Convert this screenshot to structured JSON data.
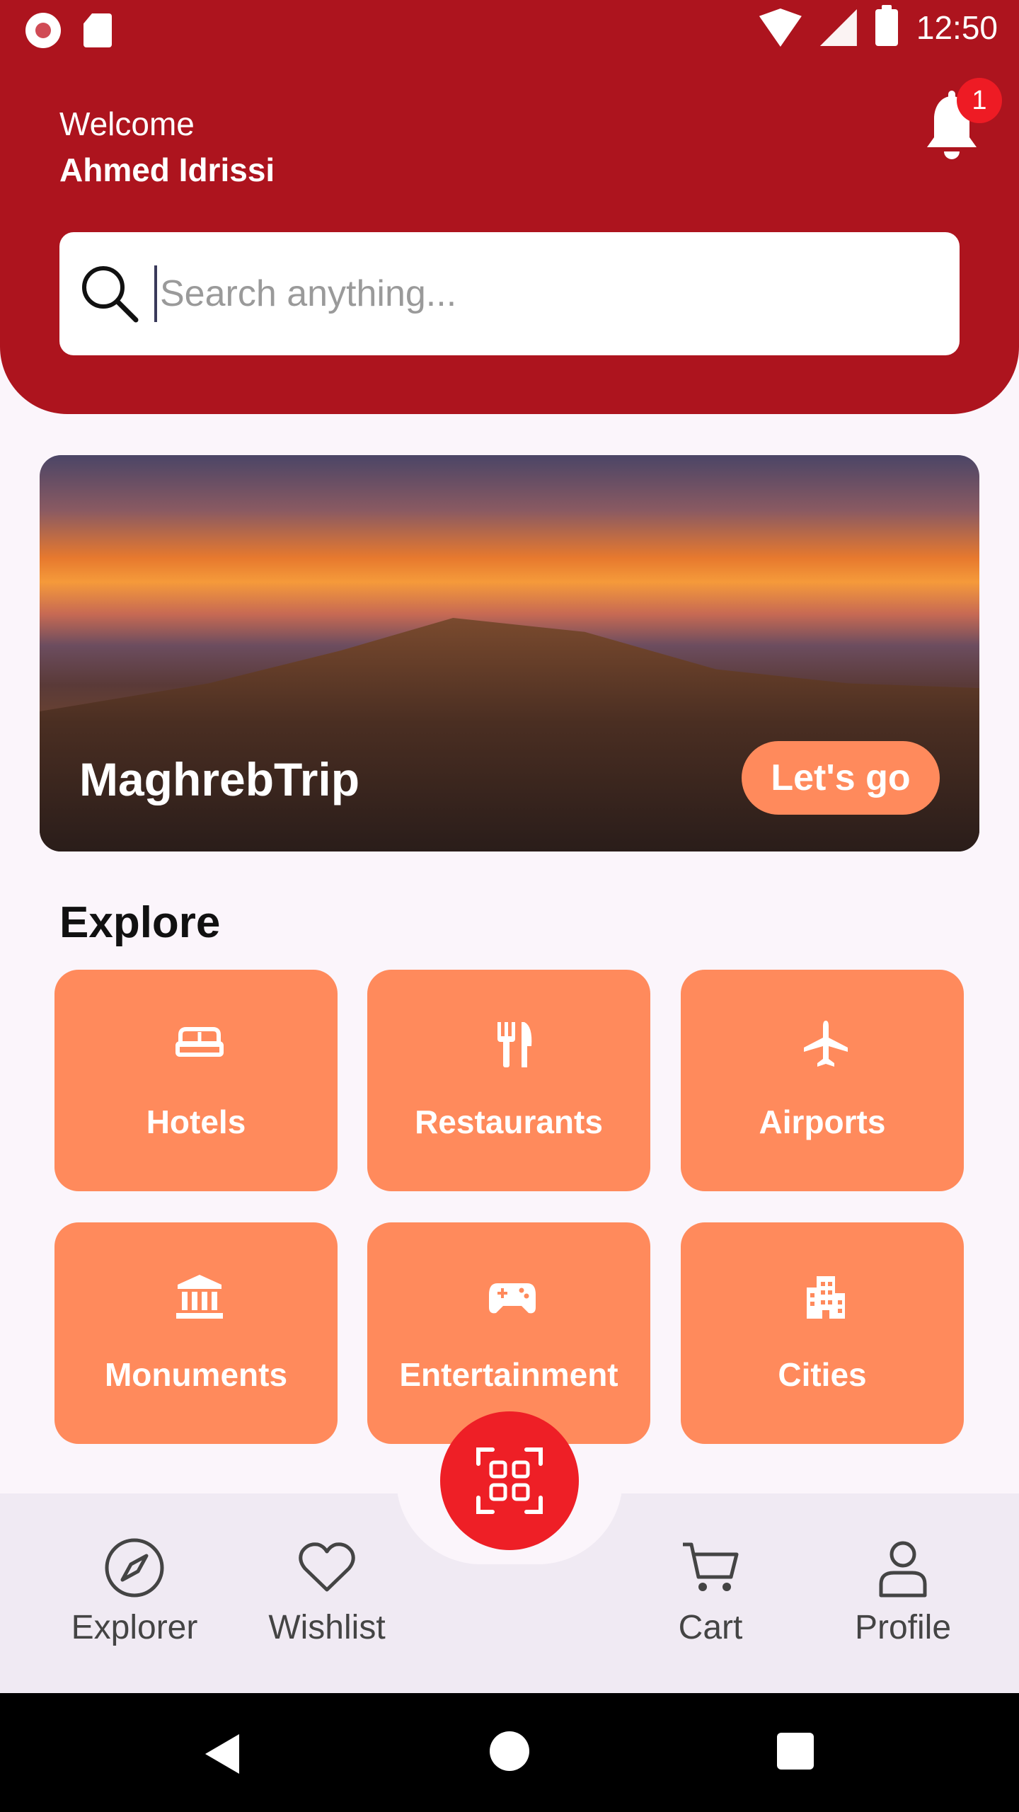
{
  "statusbar": {
    "time": "12:50"
  },
  "header": {
    "welcome": "Welcome",
    "user_name": "Ahmed Idrissi",
    "notification_count": "1"
  },
  "search": {
    "placeholder": "Search anything..."
  },
  "hero": {
    "title": "MaghrebTrip",
    "cta": "Let's go"
  },
  "explore": {
    "title": "Explore",
    "tiles": [
      {
        "label": "Hotels",
        "icon": "bed-icon"
      },
      {
        "label": "Restaurants",
        "icon": "utensils-icon"
      },
      {
        "label": "Airports",
        "icon": "airplane-icon"
      },
      {
        "label": "Monuments",
        "icon": "monument-icon"
      },
      {
        "label": "Entertainment",
        "icon": "gamepad-icon"
      },
      {
        "label": "Cities",
        "icon": "city-icon"
      }
    ]
  },
  "bottom_nav": {
    "items": [
      {
        "label": "Explorer",
        "icon": "compass-icon"
      },
      {
        "label": "Wishlist",
        "icon": "heart-icon"
      },
      {
        "label": "Cart",
        "icon": "cart-icon"
      },
      {
        "label": "Profile",
        "icon": "user-icon"
      }
    ],
    "fab_icon": "qr-scan-icon"
  },
  "colors": {
    "primary": "#ad141e",
    "accent": "#ff8a5c",
    "fab": "#ee1f26",
    "background": "#fbf5fb"
  }
}
